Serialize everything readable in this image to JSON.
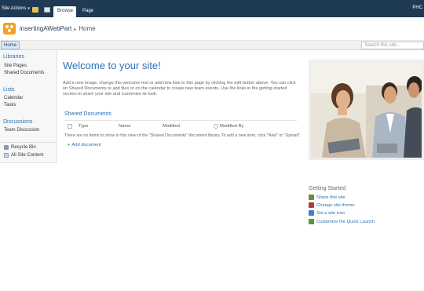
{
  "ribbon": {
    "site_actions": "Site Actions",
    "tabs": [
      "Browse",
      "Page"
    ],
    "user": "PHC"
  },
  "header": {
    "site_name": "insertingAWebPart",
    "current_page": "Home"
  },
  "topnav": {
    "home": "Home",
    "search_placeholder": "Search this site..."
  },
  "sidebar": {
    "libraries": {
      "heading": "Libraries",
      "items": [
        "Site Pages",
        "Shared Documents"
      ]
    },
    "lists": {
      "heading": "Lists",
      "items": [
        "Calendar",
        "Tasks"
      ]
    },
    "discussions": {
      "heading": "Discussions",
      "items": [
        "Team Discussion"
      ]
    },
    "footer": [
      "Recycle Bin",
      "All Site Content"
    ]
  },
  "main": {
    "title": "Welcome to your site!",
    "intro": "Add a new image, change this welcome text or add new lists to this page by clicking the edit button above. You can click on Shared Documents to add files or on the calendar to create new team events. Use the links in the getting started section to share your site and customize its look.",
    "shared_docs": {
      "title": "Shared Documents",
      "columns": [
        "Type",
        "Name",
        "Modified",
        "Modified By"
      ],
      "empty_message": "There are no items to show in this view of the \"Shared Documents\" document library. To add a new item, click \"New\" or \"Upload\".",
      "add_label": "Add document"
    }
  },
  "getting_started": {
    "title": "Getting Started",
    "items": [
      {
        "label": "Share this site",
        "icon": "share-site-icon",
        "color": "#6a8e2f"
      },
      {
        "label": "Change site theme",
        "icon": "theme-icon",
        "color": "#b23a3a"
      },
      {
        "label": "Set a site icon",
        "icon": "site-icon-icon",
        "color": "#3f7fc2"
      },
      {
        "label": "Customize the Quick Launch",
        "icon": "quick-launch-icon",
        "color": "#4f9a3c"
      }
    ]
  },
  "colors": {
    "ribbon": "#1f3a55",
    "link": "#2a71b8",
    "logo": "#f0a023"
  }
}
